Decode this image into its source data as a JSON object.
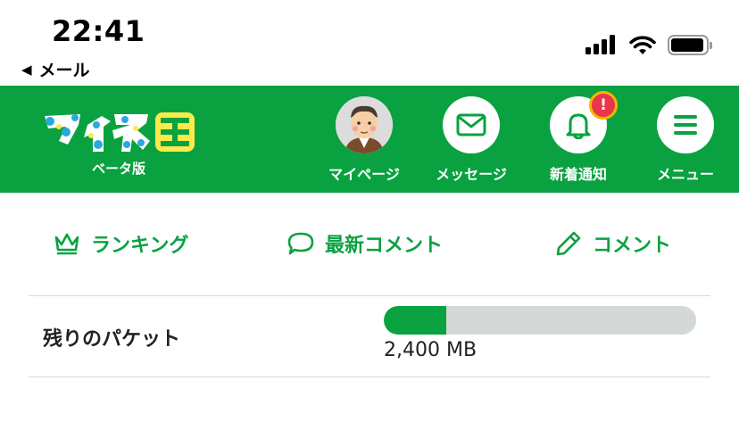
{
  "status_bar": {
    "time": "22:41",
    "back_label": "メール",
    "back_icon": "back-triangle-icon"
  },
  "header": {
    "background_color": "#0aa240",
    "logo_text": "マイネ王",
    "logo_sub": "ベータ版",
    "nav": [
      {
        "label": "マイページ",
        "icon": "avatar"
      },
      {
        "label": "メッセージ",
        "icon": "envelope-icon"
      },
      {
        "label": "新着通知",
        "icon": "bell-icon",
        "badge": "!"
      },
      {
        "label": "メニュー",
        "icon": "hamburger-icon"
      }
    ]
  },
  "quick_links": [
    {
      "label": "ランキング",
      "icon": "crown-icon"
    },
    {
      "label": "最新コメント",
      "icon": "speech-bubble-icon"
    },
    {
      "label": "コメント",
      "icon": "pencil-icon"
    }
  ],
  "packet": {
    "label": "残りのパケット",
    "value_text": "2,400 MB",
    "fill_fraction": 0.2,
    "fill_color": "#0aa240"
  }
}
